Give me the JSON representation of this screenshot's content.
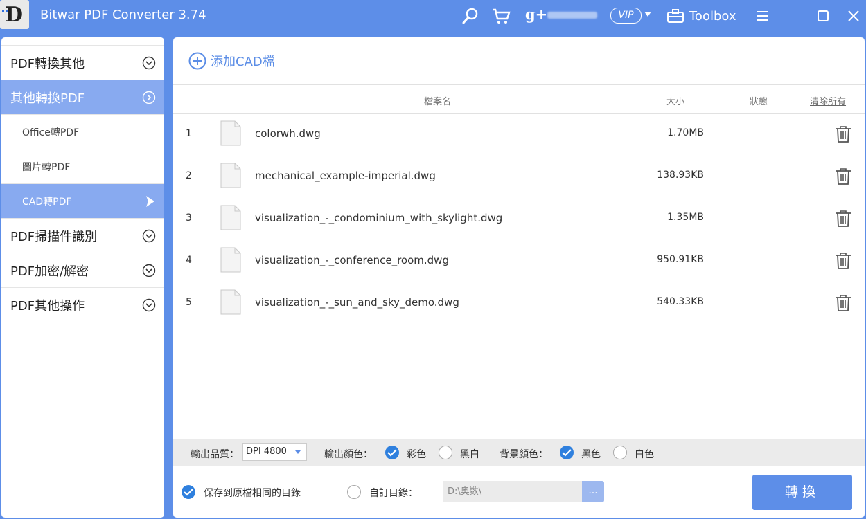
{
  "app": {
    "title": "Bitwar PDF Converter 3.74",
    "logo_letter": "D",
    "vip_label": "VIP",
    "toolbox_label": "Toolbox",
    "accent_color": "#5d8ee8"
  },
  "icons": {
    "search": "search-icon",
    "cart": "cart-icon",
    "gplus": "google-plus-icon",
    "menu": "hamburger-icon",
    "maximize": "maximize-icon",
    "close": "close-icon"
  },
  "gplus_label": "g+",
  "sidebar": {
    "items": [
      {
        "label": "PDF轉換其他"
      },
      {
        "label": "其他轉換PDF"
      },
      {
        "label": "Office轉PDF"
      },
      {
        "label": "圖片轉PDF"
      },
      {
        "label": "CAD轉PDF"
      },
      {
        "label": "PDF掃描件識別"
      },
      {
        "label": "PDF加密/解密"
      },
      {
        "label": "PDF其他操作"
      }
    ]
  },
  "main": {
    "add_label": "添加CAD檔",
    "columns": {
      "name": "檔案名",
      "size": "大小",
      "status": "狀態",
      "clear": "清除所有"
    },
    "files": [
      {
        "num": "1",
        "name": "colorwh.dwg",
        "size": "1.70MB"
      },
      {
        "num": "2",
        "name": "mechanical_example-imperial.dwg",
        "size": "138.93KB"
      },
      {
        "num": "3",
        "name": "visualization_-_condominium_with_skylight.dwg",
        "size": "1.35MB"
      },
      {
        "num": "4",
        "name": "visualization_-_conference_room.dwg",
        "size": "950.91KB"
      },
      {
        "num": "5",
        "name": "visualization_-_sun_and_sky_demo.dwg",
        "size": "540.33KB"
      }
    ]
  },
  "options": {
    "quality_label": "輸出品質：",
    "quality_value": "DPI 4800",
    "color_label": "輸出顏色：",
    "color_options": [
      "彩色",
      "黑白"
    ],
    "bg_label": "背景顏色：",
    "bg_options": [
      "黑色",
      "白色"
    ]
  },
  "bottom": {
    "save_same_label": "保存到原檔相同的目錄",
    "custom_dir_label": "自訂目錄：",
    "path_placeholder": "D:\\奥数\\",
    "browse_label": "...",
    "convert_label": "轉換"
  }
}
